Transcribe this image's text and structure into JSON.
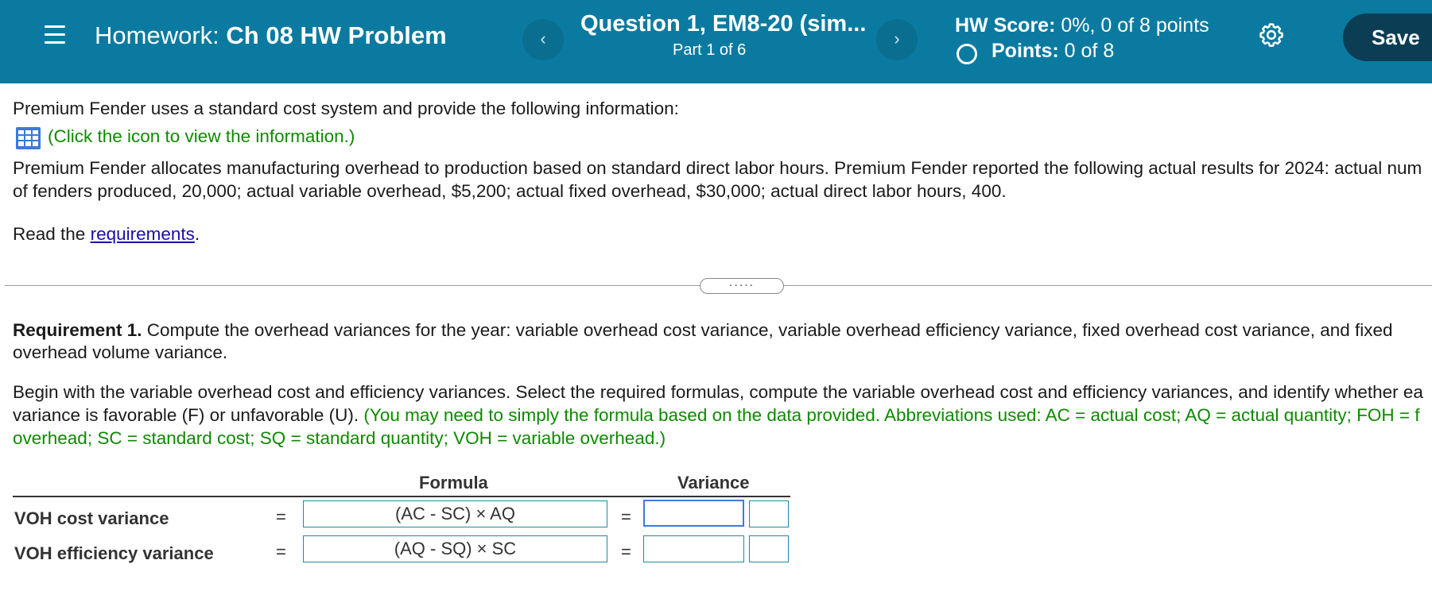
{
  "header": {
    "homework_prefix": "Homework:",
    "homework_name": "Ch 08 HW Problem",
    "question_title": "Question 1, EM8-20 (sim...",
    "question_part": "Part 1 of 6",
    "hw_score_label": "HW Score:",
    "hw_score_value": "0%, 0 of 8 points",
    "points_label": "Points:",
    "points_value": "0 of 8",
    "save_label": "Save",
    "prev_icon": "‹",
    "next_icon": "›"
  },
  "content": {
    "intro": "Premium Fender uses a standard cost system and provide the following information:",
    "click_info": "(Click the icon to view the information.)",
    "para1_line1": "Premium Fender allocates manufacturing overhead to production based on standard direct labor hours. Premium Fender reported the following actual results for 2024: actual num",
    "para1_line2": "of fenders produced, 20,000; actual variable overhead, $5,200; actual fixed overhead, $30,000; actual direct labor hours, 400.",
    "read_prefix": "Read the ",
    "read_link": "requirements",
    "read_suffix": ".",
    "divider_dots": ".....",
    "req_label": "Requirement 1.",
    "req_text_line1": " Compute the overhead variances for the year: variable overhead cost variance, variable overhead efficiency variance, fixed overhead cost variance, and fixed",
    "req_text_line2": "overhead volume variance.",
    "begin_line1": "Begin with the variable overhead cost and efficiency variances. Select the required formulas, compute the variable overhead cost and efficiency variances, and identify whether ea",
    "begin_line2_black": "variance is favorable (F) or unfavorable (U).",
    "begin_line2_green": " (You may need to simply the formula based on the data provided. Abbreviations used: AC = actual cost; AQ = actual quantity; FOH = f",
    "begin_line3_green": "overhead; SC = standard cost; SQ = standard quantity; VOH = variable overhead.)"
  },
  "table": {
    "col_formula": "Formula",
    "col_variance": "Variance",
    "rows": [
      {
        "label": "VOH cost variance",
        "eq1": "=",
        "formula": "(AC - SC) × AQ",
        "eq2": "=",
        "variance": "",
        "fu": ""
      },
      {
        "label": "VOH efficiency variance",
        "eq1": "=",
        "formula": "(AQ - SQ) × SC",
        "eq2": "=",
        "variance": "",
        "fu": ""
      }
    ]
  },
  "colors": {
    "header_bg": "#0b7aa0",
    "save_bg": "#0b3e54",
    "green_text": "#0e8a00",
    "link": "#1a0dab",
    "input_border": "#1a8c9a"
  },
  "icons": [
    "menu-icon",
    "chevron-left-icon",
    "chevron-right-icon",
    "gear-icon",
    "table-grid-icon"
  ]
}
